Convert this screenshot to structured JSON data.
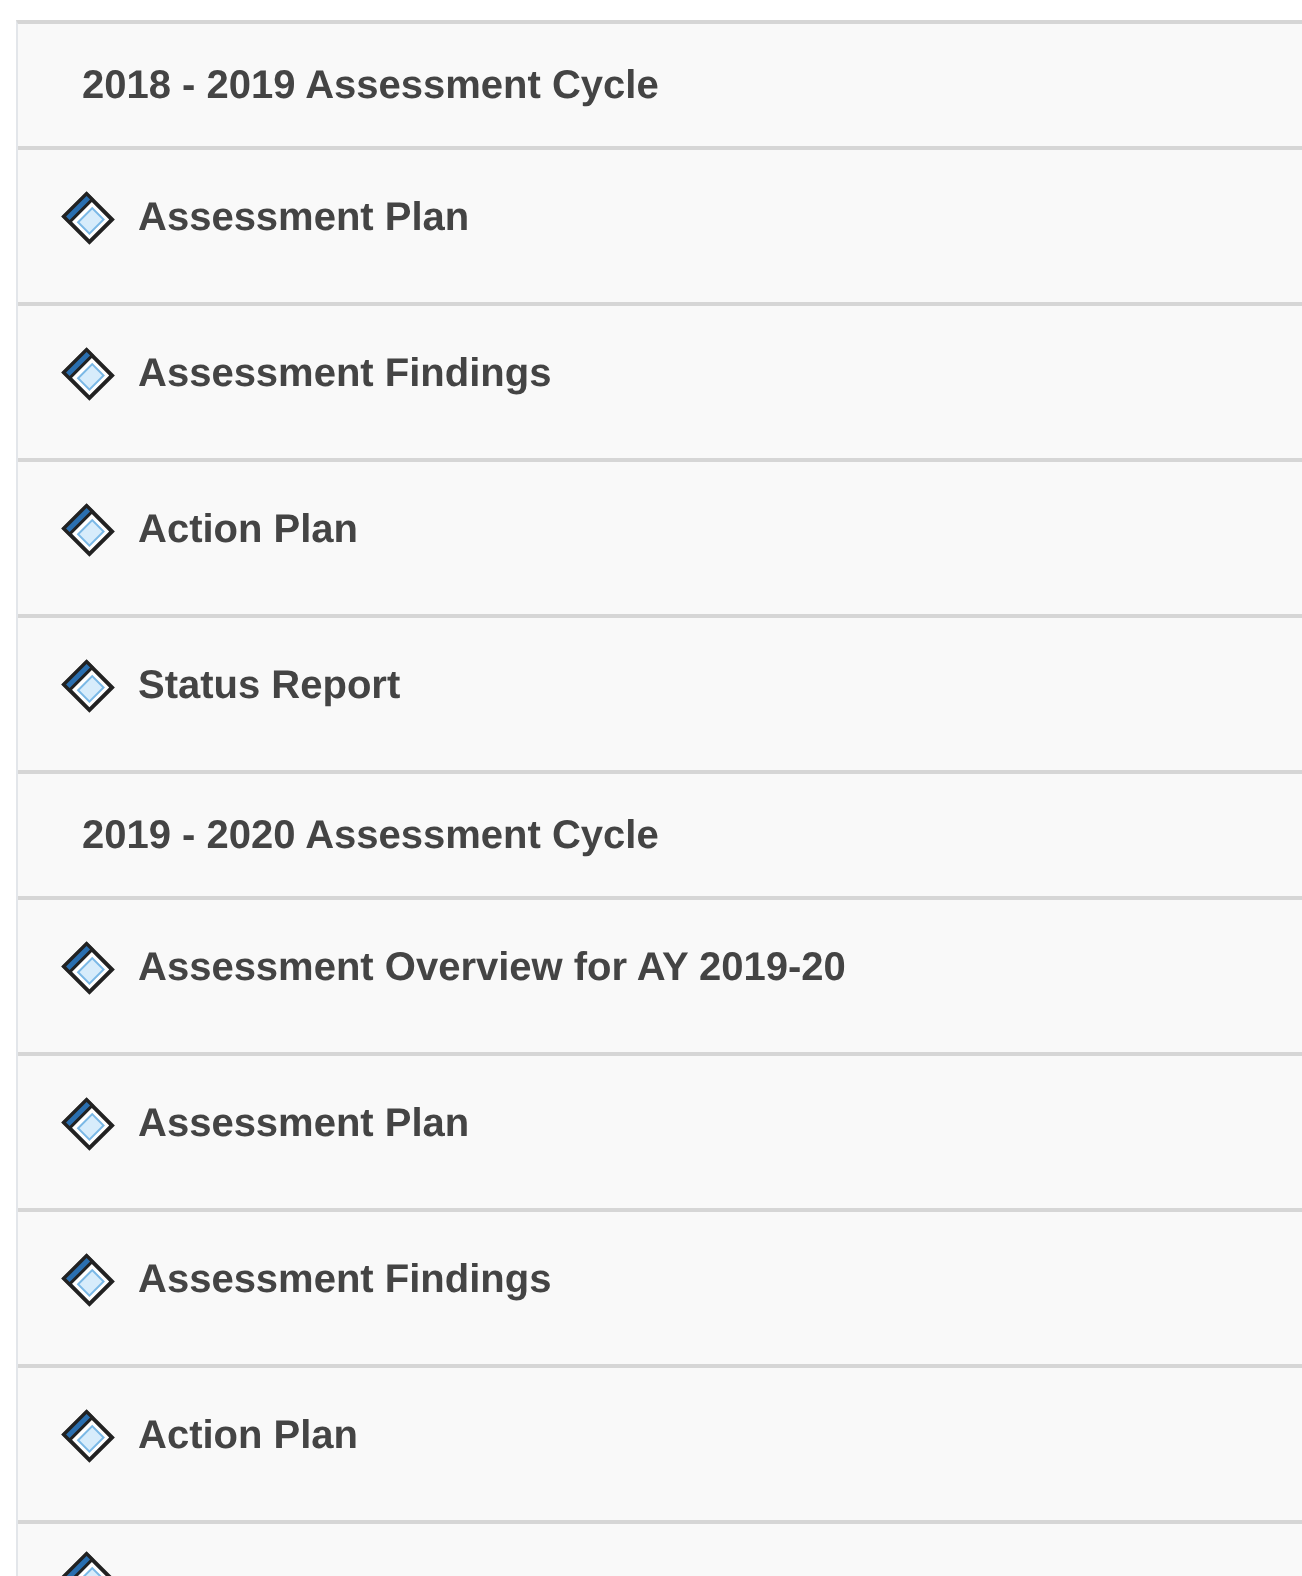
{
  "sections": [
    {
      "title": "2018 - 2019 Assessment Cycle",
      "items": [
        {
          "label": "Assessment Plan"
        },
        {
          "label": "Assessment Findings"
        },
        {
          "label": "Action Plan"
        },
        {
          "label": "Status Report"
        }
      ]
    },
    {
      "title": "2019 - 2020 Assessment Cycle",
      "items": [
        {
          "label": "Assessment Overview for AY 2019-20"
        },
        {
          "label": "Assessment Plan"
        },
        {
          "label": "Assessment Findings"
        },
        {
          "label": "Action Plan"
        },
        {
          "kind": "cut"
        }
      ]
    }
  ]
}
